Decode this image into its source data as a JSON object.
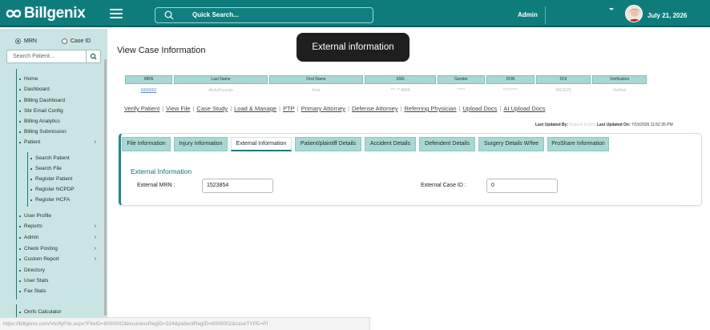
{
  "app": {
    "name": "Billgenix"
  },
  "header": {
    "search_placeholder": "Quick Search...",
    "user_label": "Admin",
    "date": "July 21, 2026"
  },
  "sidebar": {
    "radio_mrn": "MRN",
    "radio_caseid": "Case ID",
    "search_placeholder": "Search Patient...",
    "items": [
      {
        "label": "Home"
      },
      {
        "label": "Dashboard"
      },
      {
        "label": "Billing Dashboard"
      },
      {
        "label": "Sbr Email Config"
      },
      {
        "label": "Billing Analytics"
      },
      {
        "label": "Billing Submission"
      },
      {
        "label": "Patient",
        "chevron": "‹"
      },
      {
        "label": "User Profile"
      },
      {
        "label": "Reports",
        "chevron": "›"
      },
      {
        "label": "Admin",
        "chevron": "›"
      },
      {
        "label": "Check Posting",
        "chevron": "›"
      },
      {
        "label": "Custom Report",
        "chevron": "›"
      },
      {
        "label": "Directory"
      },
      {
        "label": "User Stats"
      },
      {
        "label": "Fax Stats"
      },
      {
        "label": "Omfs Calculator"
      }
    ],
    "patient_sub": [
      {
        "label": "Search Patient"
      },
      {
        "label": "Search File"
      },
      {
        "label": "Register Patient"
      },
      {
        "label": "Register NCPDP"
      },
      {
        "label": "Register HCFA"
      }
    ]
  },
  "status_url": "https://billgenix.com/VerifyFile.aspx?FileID=6000002&businessRegID=324&patientRegID=6000002&caseTYPE=PI",
  "page": {
    "title": "View Case Information",
    "tooltip": "External information"
  },
  "summary": {
    "headers": [
      "MRN",
      "Last Name",
      "First Name",
      "SSN",
      "Gender",
      "DOB",
      "DOI",
      "Verification"
    ],
    "values": [
      "6000002",
      "AbdulHussain",
      "Amir",
      "***-**-8888",
      "*****",
      "**/**/****",
      "8/8/2025",
      "Verified"
    ]
  },
  "links": [
    "Verify Patient",
    "View File",
    "Case Study",
    "Load & Manage",
    "PTP",
    "Primary Attorney",
    "Defense Attorney",
    "Referring Physician",
    "Upload Docs",
    "AI Upload Docs"
  ],
  "last_updated": {
    "by_label": "Last Updated By:",
    "by_value": "Rakesh Kumar",
    "on_label": "Last Updated On:",
    "on_value": "7/15/2026 11:52:35 PM"
  },
  "tabs": [
    {
      "label": "File Information"
    },
    {
      "label": "Injury Information"
    },
    {
      "label": "External Information",
      "active": true
    },
    {
      "label": "Patient/plaintiff Details"
    },
    {
      "label": "Accident Details"
    },
    {
      "label": "Defendent Details"
    },
    {
      "label": "Surgery Details W/fee"
    },
    {
      "label": "ProShare Information"
    }
  ],
  "external": {
    "section_title": "External Information",
    "mrn_label": "External MRN :",
    "mrn_value": "1523854",
    "case_label": "External Case ID :",
    "case_value": "0"
  },
  "colors": {
    "brand": "#0f7c7c",
    "sidebar": "#c9e5e3",
    "tab": "#a8d8d4"
  }
}
